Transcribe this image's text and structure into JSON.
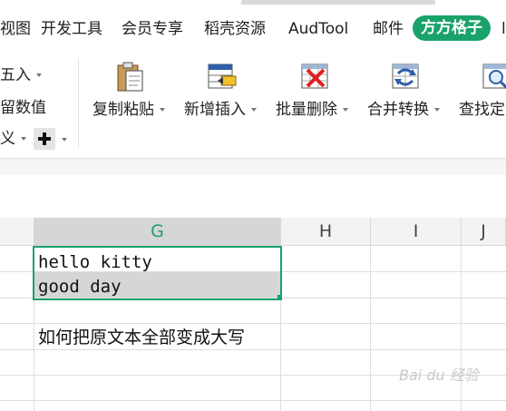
{
  "menu": {
    "items": [
      "视图",
      "开发工具",
      "会员专享",
      "稻壳资源",
      "AudTool",
      "邮件"
    ],
    "active": "方方格子",
    "overflow": "l"
  },
  "ribbon": {
    "left_group": {
      "row1": "五入",
      "row2": "留数值",
      "row3": "义"
    },
    "buttons": [
      {
        "label": "复制粘贴",
        "icon": "clipboard-paste-icon"
      },
      {
        "label": "新增插入",
        "icon": "insert-row-icon"
      },
      {
        "label": "批量删除",
        "icon": "delete-table-icon"
      },
      {
        "label": "合并转换",
        "icon": "merge-convert-icon"
      },
      {
        "label": "查找定",
        "icon": "find-locate-icon"
      }
    ],
    "plus_icon": "plus-icon"
  },
  "sheet": {
    "columns": [
      "G",
      "H",
      "I",
      "J"
    ],
    "selected_column": "G",
    "cells": {
      "g1": "hello kitty",
      "g2": "good day",
      "g4": "如何把原文本全部变成大写"
    }
  },
  "watermark": "Bai du 经验",
  "colors": {
    "accent": "#1aa26b",
    "selection_border": "#1aa26b",
    "selected_cell_bg": "#d6d6d6"
  }
}
